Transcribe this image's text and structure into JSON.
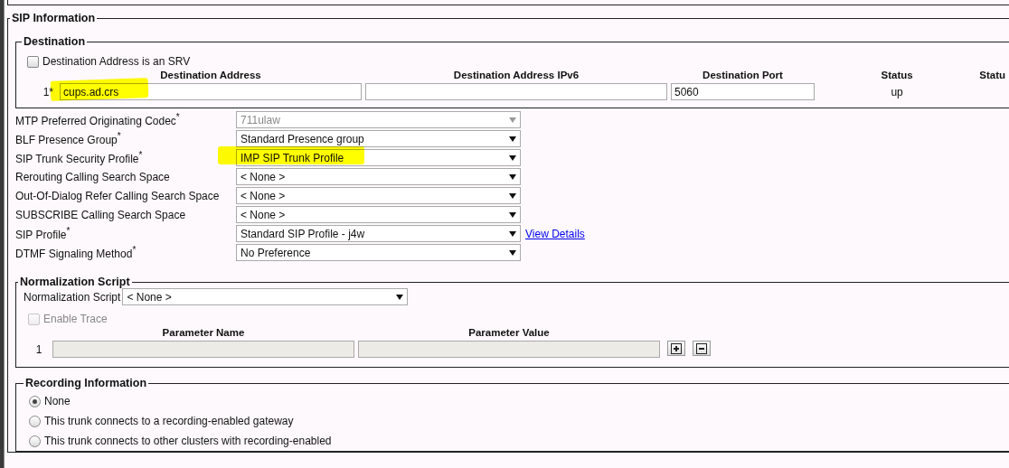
{
  "sip_information": {
    "title": "SIP Information",
    "destination": {
      "title": "Destination",
      "srv_checkbox": {
        "label": "Destination Address is an SRV",
        "checked": false
      },
      "columns": [
        "Destination Address",
        "Destination Address IPv6",
        "Destination Port",
        "Status",
        "Statu"
      ],
      "rows": [
        {
          "index": "1*",
          "address": "cups.ad.crs",
          "address_highlighted": true,
          "port": "5060",
          "status": "up"
        }
      ]
    },
    "settings": [
      {
        "label": "MTP Preferred Originating Codec$^{*}$",
        "value": "711ulaw",
        "disabled": true,
        "highlighted": false
      },
      {
        "label": "BLF Presence Group$^{*}$",
        "value": "Standard Presence group",
        "disabled": false,
        "highlighted": false
      },
      {
        "label": "SIP Trunk Security Profile$^{*}$",
        "value": "IMP SIP Trunk Profile",
        "disabled": false,
        "highlighted": true
      },
      {
        "label": "Rerouting Calling Search Space",
        "value": "< None >",
        "disabled": false,
        "highlighted": false
      },
      {
        "label": "Out-Of-Dialog Refer Calling Search Space",
        "value": "< None >",
        "disabled": false,
        "highlighted": false
      },
      {
        "label": "SUBSCRIBE Calling Search Space",
        "value": "< None >",
        "disabled": false,
        "highlighted": false
      },
      {
        "label": "SIP Profile$^{*}$",
        "value": "Standard SIP Profile - j4w",
        "disabled": false,
        "highlighted": false,
        "link": "View Details"
      },
      {
        "label": "DTMF Signaling Method$^{*}$",
        "value": "No Preference",
        "disabled": false,
        "highlighted": false
      }
    ],
    "normalization": {
      "title": "Normalization Script",
      "script_label": "Normalization Script",
      "script_value": "< None >",
      "enable_trace": {
        "label": "Enable Trace",
        "checked": false,
        "disabled": true
      },
      "columns": [
        "Parameter Name",
        "Parameter Value"
      ],
      "rows": [
        {
          "index": "1"
        }
      ]
    },
    "recording": {
      "title": "Recording Information",
      "options": [
        {
          "label": "None",
          "selected": true
        },
        {
          "label": "This trunk connects to a recording-enabled gateway",
          "selected": false
        },
        {
          "label": "This trunk connects to other clusters with recording-enabled",
          "selected": false
        }
      ]
    }
  }
}
